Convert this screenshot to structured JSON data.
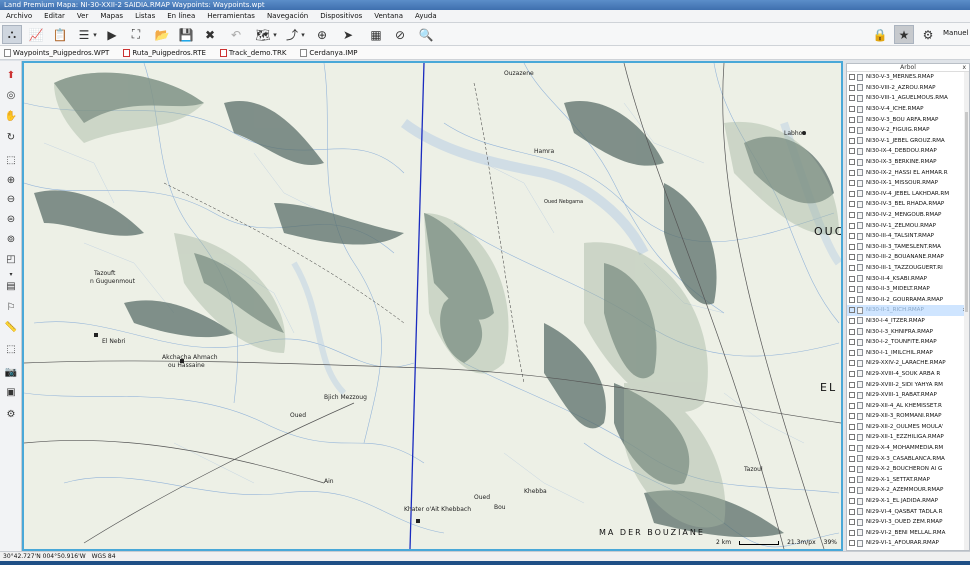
{
  "window": {
    "title": "Land Premium Mapa: NI-30-XXII-2 SAIDIA.RMAP Waypoints: Waypoints.wpt"
  },
  "menu": [
    "Archivo",
    "Editar",
    "Ver",
    "Mapas",
    "Listas",
    "En línea",
    "Herramientas",
    "Navegación",
    "Dispositivos",
    "Ventana",
    "Ayuda"
  ],
  "user": {
    "name": "Manuel"
  },
  "files": [
    {
      "name": "Waypoints_Puigpedros.WPT",
      "icon": "waypoint-file-icon"
    },
    {
      "name": "Ruta_Puigpedros.RTE",
      "icon": "route-file-icon"
    },
    {
      "name": "Track_demo.TRK",
      "icon": "track-file-icon"
    },
    {
      "name": "Cerdanya.IMP",
      "icon": "image-map-file-icon"
    }
  ],
  "tree": {
    "header": "Árbol",
    "items": [
      "NI30-V-3_MERNES.RMAP",
      "NI30-VIII-2_AZROU.RMAP",
      "NI30-VIII-1_AGUELMOUS.RMA",
      "NI30-V-4_ICHE.RMAP",
      "NI30-V-3_BOU ARFA.RMAP",
      "NI30-V-2_FIGUIG.RMAP",
      "NI30-V-1_JEBEL GROUZ.RMA",
      "NI30-IX-4_DEBDOU.RMAP",
      "NI30-IX-3_BERKINE.RMAP",
      "NI30-IX-2_HASSI EL AHMAR.R",
      "NI30-IX-1_MISSOUR.RMAP",
      "NI30-IV-4_JEBEL LAKHDAR.RM",
      "NI30-IV-3_BEL RHADA.RMAP",
      "NI30-IV-2_MENGOUB.RMAP",
      "NI30-IV-1_ZELMOU.RMAP",
      "NI30-III-4_TALSINT.RMAP",
      "NI30-III-3_TAMESLENT.RMA",
      "NI30-III-2_BOUANANE.RMAP",
      "NI30-III-1_TAZZOUGUERT.RI",
      "NI30-II-4_KSABI.RMAP",
      "NI30-II-3_MIDELT.RMAP",
      "NI30-II-2_GOURRAMA.RMAP",
      "NI30-II-1_RICH.RMAP",
      "NI30-I-4_ITZER.RMAP",
      "NI30-I-3_KHNIFRA.RMAP",
      "NI30-I-2_TOUNFITE.RMAP",
      "NI30-I-1_IMILCHIL.RMAP",
      "NI29-XXIV-2_LARACHE.RMAP",
      "NI29-XVIII-4_SOUK ARBA R",
      "NI29-XVIII-2_SIDI YAHYA RM",
      "NI29-XVIII-1_RABAT.RMAP",
      "NI29-XII-4_AL KHEMISSET.R",
      "NI29-XII-3_ROMMANI.RMAP",
      "NI29-XII-2_OULMES MOULA'",
      "NI29-XII-1_EZZHILIGA.RMAP",
      "NI29-X-4_MOHAMMEDIA.RM",
      "NI29-X-3_CASABLANCA.RMA",
      "NI29-X-2_BOUCHERON AI G",
      "NI29-X-1_SETTAT.RMAP",
      "NI29-X-2_AZEMMOUR.RMAP",
      "NI29-X-1_EL JADIDA.RMAP",
      "NI29-VI-4_QASBAT TADLA.R",
      "NI29-VI-3_OUED ZEM.RMAP",
      "NI29-VI-2_BENI MELLAL.RMA",
      "NI29-VI-1_AFOURAR.RMAP"
    ],
    "selected_index": 22,
    "selected_close": "x"
  },
  "map": {
    "labels": {
      "tazouft": "Tazouft",
      "guguenmout": "n Guguenmout",
      "nebri": "El Nebri",
      "akchacha": "Akchacha Ahmach",
      "akchacha2": "ou Hassaine",
      "oued_belm": "Oued",
      "belm_mezzoug": "Bjich Mezzoug",
      "nebgama": "Oued Nebgama",
      "ain": "Ain",
      "outanouche": "Ouzazene",
      "labhou": "Labhou",
      "ouc": "OUC",
      "el": "EL",
      "tazoul": "Tazoul",
      "ma_der": "MA DER BOUZIANE",
      "khatar": "Khater o'Ait Khebbach",
      "khebba": "Khebba",
      "bou": "Bou",
      "oued2": "Oued",
      "hamra": "Hamra"
    }
  },
  "scale": {
    "distance": "2 km",
    "speed": "21.3m/px",
    "zoom": "39%"
  },
  "status": {
    "coords": "30°42.727'N 004°50.916'W",
    "datum": "WGS 84"
  }
}
